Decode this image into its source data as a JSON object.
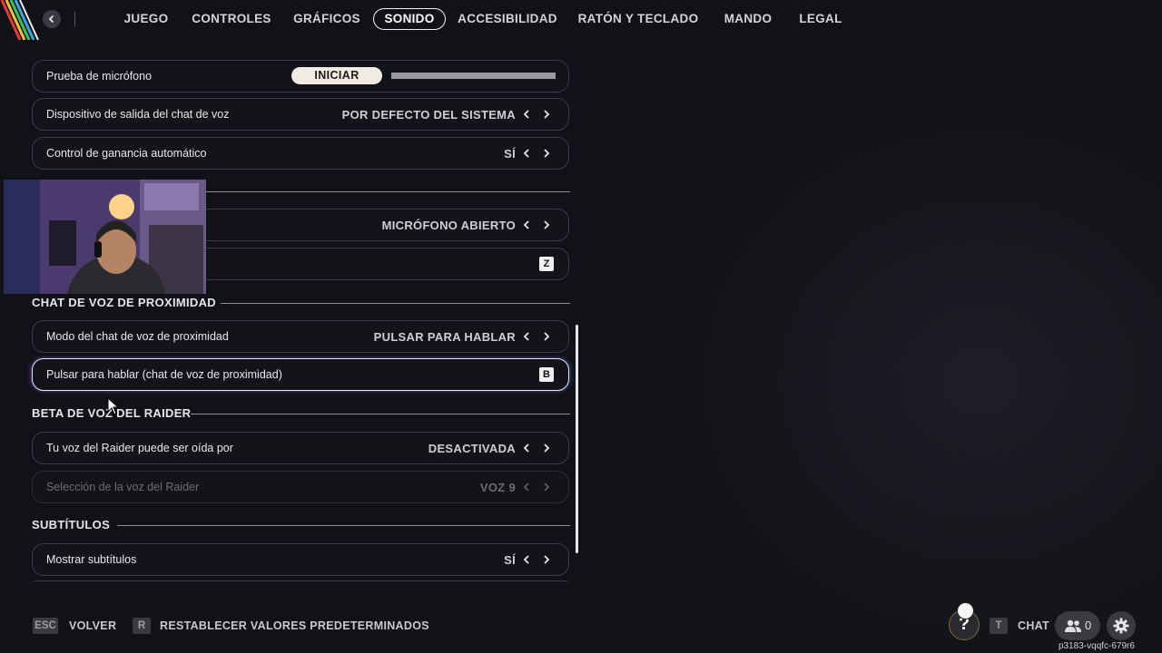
{
  "nav": {
    "tabs": [
      "JUEGO",
      "CONTROLES",
      "GRÁFICOS",
      "SONIDO",
      "ACCESIBILIDAD",
      "RATÓN Y TECLADO",
      "MANDO",
      "LEGAL"
    ],
    "active_tab": "SONIDO"
  },
  "settings": {
    "mic_test": {
      "label": "Prueba de micrófono",
      "button": "INICIAR",
      "level": 0
    },
    "voice_output": {
      "label": "Dispositivo de salida del chat de voz",
      "value": "POR DEFECTO DEL SISTEMA"
    },
    "auto_gain": {
      "label": "Control de ganancia automático",
      "value": "SÍ"
    },
    "voice_mode": {
      "value": "MICRÓFONO ABIERTO"
    },
    "push_to_talk_key": {
      "key": "Z"
    },
    "proximity_section": "CHAT DE VOZ DE PROXIMIDAD",
    "proximity_mode": {
      "label": "Modo del chat de voz de proximidad",
      "value": "PULSAR PARA HABLAR"
    },
    "proximity_ptt": {
      "label": "Pulsar para hablar (chat de voz de proximidad)",
      "key": "B"
    },
    "raider_section": "BETA DE VOZ DEL RAIDER",
    "raider_heard_by": {
      "label": "Tu voz del Raider puede ser oída por",
      "value": "DESACTIVADA"
    },
    "raider_voice_select": {
      "label": "Selección de la voz del Raider",
      "value": "VOZ 9"
    },
    "subtitles_section": "SUBTÍTULOS",
    "show_subtitles": {
      "label": "Mostrar subtítulos",
      "value": "SÍ"
    }
  },
  "footer": {
    "back_key": "ESC",
    "back_label": "VOLVER",
    "reset_key": "R",
    "reset_label": "RESTABLECER VALORES PREDETERMINADOS",
    "chat_key": "T",
    "chat_label": "CHAT",
    "friends_count": "0",
    "build_id": "p3183-vqqfc-679r6"
  },
  "icons": {
    "back": "chevron-left-icon",
    "arrow_left": "chevron-left-icon",
    "arrow_right": "chevron-right-icon",
    "help": "question-mark-icon",
    "friends": "people-icon",
    "settings": "gear-icon"
  },
  "colors": {
    "background": "#14151b",
    "text": "#e9e9ea",
    "row_border": "#3a3b43",
    "accent_button": "#f0ece4"
  }
}
